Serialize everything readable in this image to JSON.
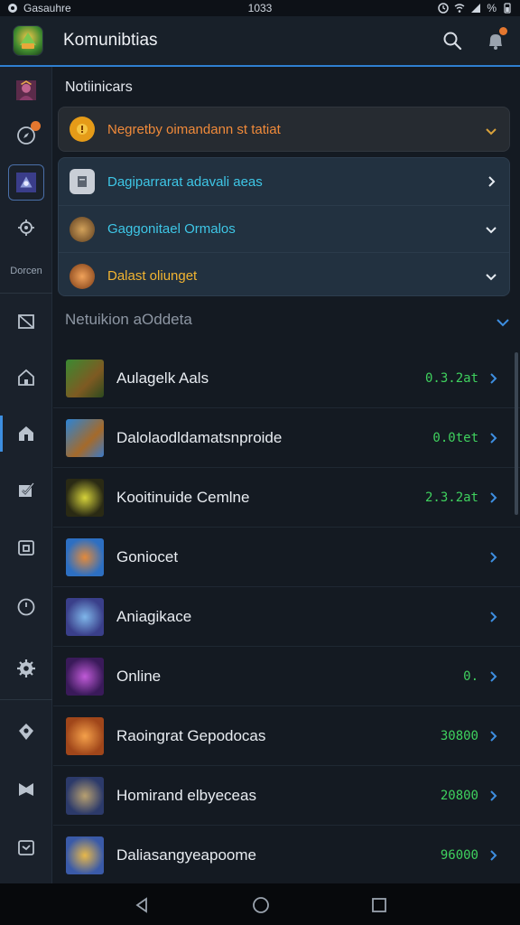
{
  "status_bar": {
    "carrier": "Gasauhre",
    "time": "1033",
    "battery": "%"
  },
  "app": {
    "title": "Komunibtias",
    "accent_color": "#2f7fd0",
    "header_icons": [
      "search-icon",
      "bell-icon"
    ]
  },
  "rail": {
    "label": "Dorcen",
    "icons": [
      "avatar-icon",
      "compass-icon",
      "mech-icon",
      "settings-gear-small-icon",
      "inbox-icon",
      "home-icon",
      "home-alt-icon",
      "check-icon",
      "camera-icon",
      "history-icon",
      "gear-icon",
      "location-icon",
      "shield-icon",
      "message-icon"
    ]
  },
  "notifications": {
    "title": "Notiinicars",
    "alert": {
      "text": "Negretby oimandann st tatiat",
      "color": "#f08a3a"
    },
    "group": [
      {
        "text": "Dagiparrarat adavali aeas",
        "color": "#3ec6e6"
      },
      {
        "text": "Gaggonitael Ormalos",
        "color": "#3ec6e6"
      },
      {
        "text": "Dalast oliunget",
        "color": "#f2b431"
      }
    ]
  },
  "updates": {
    "header": "Netuikion aOddeta",
    "items": [
      {
        "label": "Aulagelk Aals",
        "value": "0.3.2at"
      },
      {
        "label": "Dalolaodldamatsnproide",
        "value": "0.0tet"
      },
      {
        "label": "Kooitinuide Cemlne",
        "value": "2.3.2at"
      },
      {
        "label": "Goniocet",
        "value": ""
      },
      {
        "label": "Aniagikace",
        "value": ""
      },
      {
        "label": "Online",
        "value": "0."
      },
      {
        "label": "Raoingrat Gepodocas",
        "value": "30800"
      },
      {
        "label": "Homirand elbyeceas",
        "value": "20800"
      },
      {
        "label": "Daliasangyeapoome",
        "value": "96000"
      }
    ],
    "value_color": "#3fd15e"
  }
}
